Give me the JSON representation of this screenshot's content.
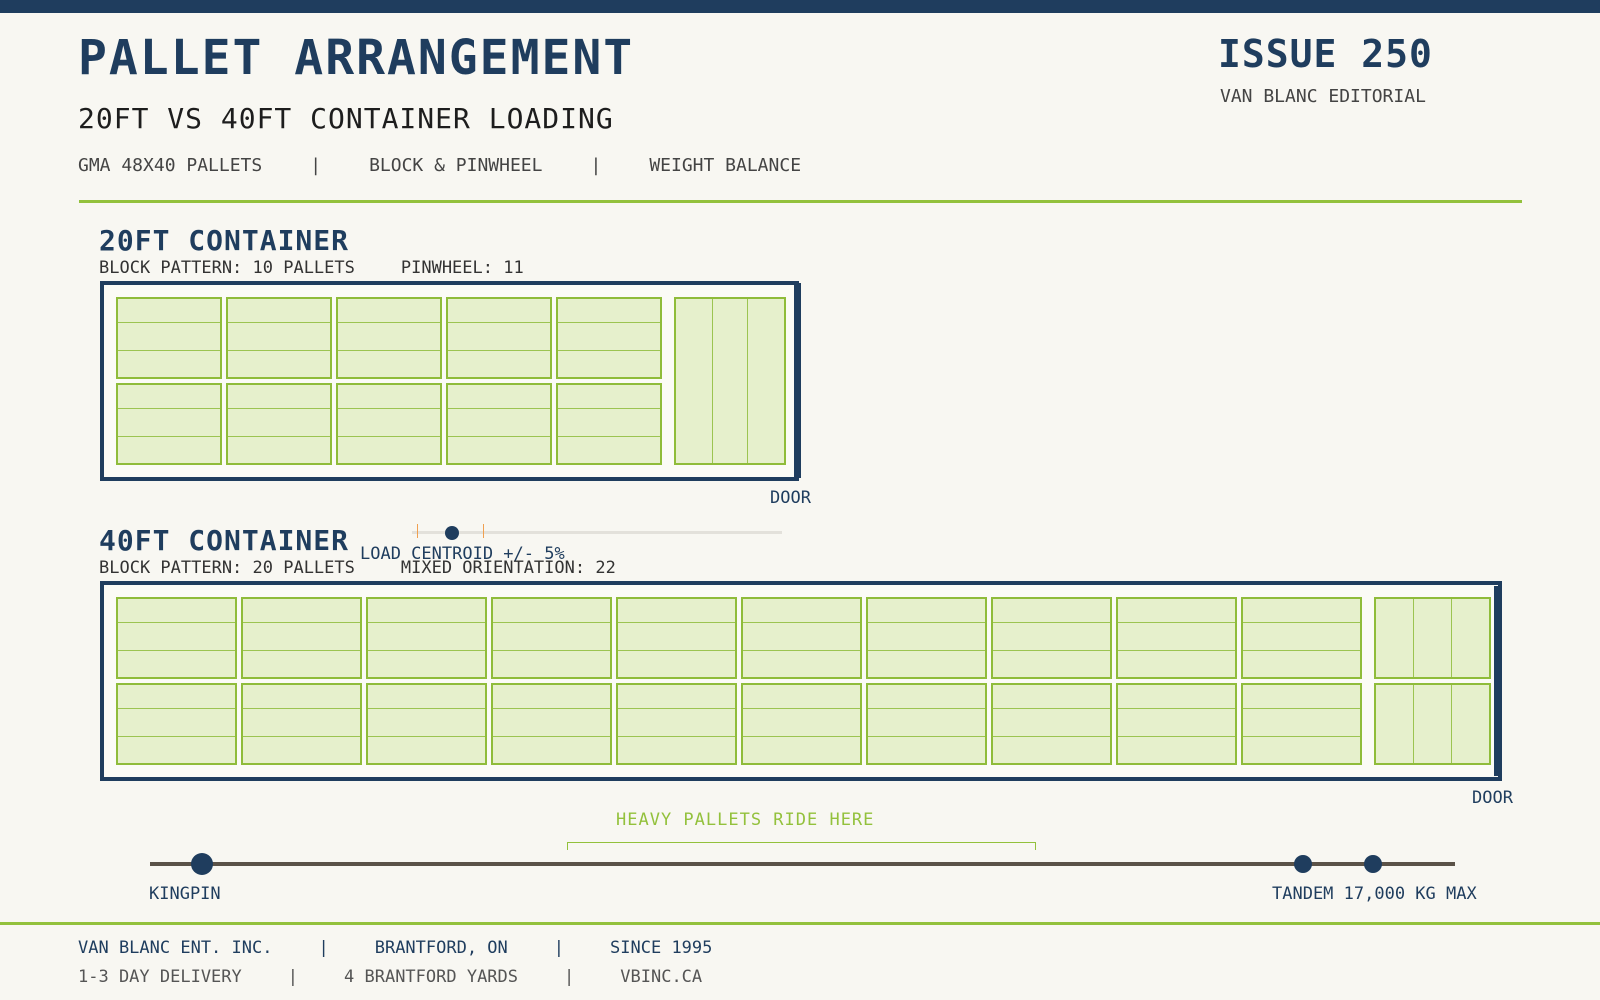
{
  "header": {
    "title": "PALLET ARRANGEMENT",
    "subtitle": "20FT VS 40FT CONTAINER LOADING",
    "tags": [
      "GMA 48X40 PALLETS",
      "BLOCK & PINWHEEL",
      "WEIGHT BALANCE"
    ],
    "tag_separator": "|",
    "issue": "ISSUE 250",
    "publisher": "VAN BLANC EDITORIAL"
  },
  "container_20": {
    "title": "20FT CONTAINER",
    "meta_block": "BLOCK PATTERN: 10 PALLETS",
    "meta_alt": "PINWHEEL: 11",
    "door_label": "DOOR",
    "rows": 2,
    "cols": 5,
    "turned_pallets": 1
  },
  "container_40": {
    "title": "40FT CONTAINER",
    "meta_block": "BLOCK PATTERN: 20 PALLETS",
    "meta_alt": "MIXED ORIENTATION: 22",
    "door_label": "DOOR",
    "rows": 2,
    "cols": 10,
    "turned_pallets": 2
  },
  "centroid": {
    "label": "LOAD CENTROID +/- 5%"
  },
  "axle": {
    "heavy_label": "HEAVY PALLETS RIDE HERE",
    "kingpin_label": "KINGPIN",
    "tandem_label": "TANDEM 17,000 KG MAX"
  },
  "footer": {
    "line1": [
      "VAN BLANC ENT. INC.",
      "BRANTFORD, ON",
      "SINCE 1995"
    ],
    "line2": [
      "1-3 DAY DELIVERY",
      "4 BRANTFORD YARDS",
      "VBINC.CA"
    ],
    "separator": "|"
  },
  "colors": {
    "navy": "#1f3d5e",
    "green": "#93c13c",
    "pallet_fill": "#e6f0cc",
    "background": "#f8f7f2"
  }
}
